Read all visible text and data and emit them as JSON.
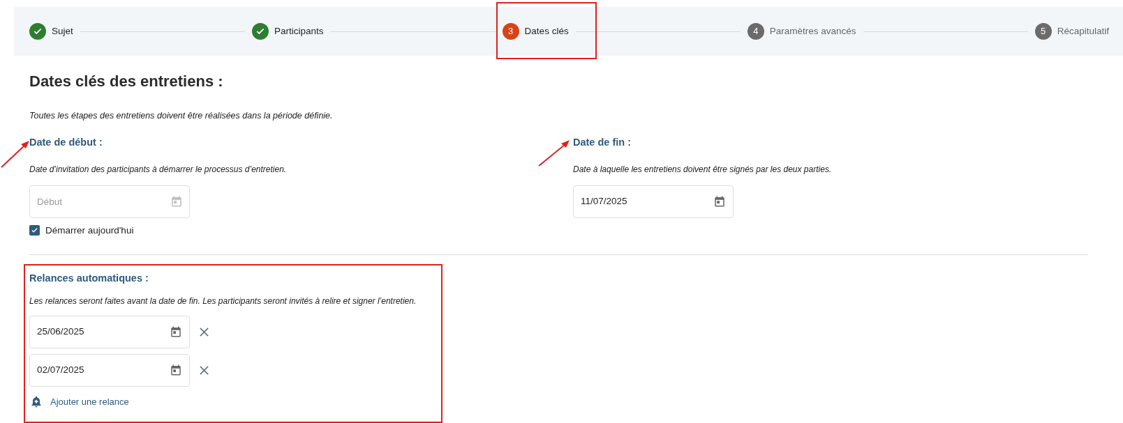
{
  "stepper": [
    {
      "label": "Sujet",
      "kind": "done"
    },
    {
      "label": "Participants",
      "kind": "done"
    },
    {
      "number": "3",
      "label": "Dates clés",
      "kind": "current"
    },
    {
      "number": "4",
      "label": "Paramètres avancés",
      "kind": "upcoming"
    },
    {
      "number": "5",
      "label": "Récapitulatif",
      "kind": "upcoming"
    }
  ],
  "heading": "Dates clés des entretiens :",
  "intro": "Toutes les étapes des entretiens doivent être réalisées dans la période définie.",
  "start": {
    "title": "Date de début :",
    "description": "Date d’invitation des participants à démarrer le processus d’entretien.",
    "placeholder": "Début",
    "disabled": true,
    "checkbox": {
      "label": "Démarrer aujourd'hui",
      "checked": true
    }
  },
  "end": {
    "title": "Date de fin :",
    "description": "Date à laquelle les entretiens doivent être signés par les deux parties.",
    "value": "11/07/2025",
    "disabled": false
  },
  "reminders": {
    "title": "Relances automatiques :",
    "description": "Les relances seront faites avant la date de fin. Les participants seront invités à relire et signer l’entretien.",
    "items": [
      {
        "value": "25/06/2025"
      },
      {
        "value": "02/07/2025"
      }
    ],
    "add_label": "Ajouter une relance"
  }
}
